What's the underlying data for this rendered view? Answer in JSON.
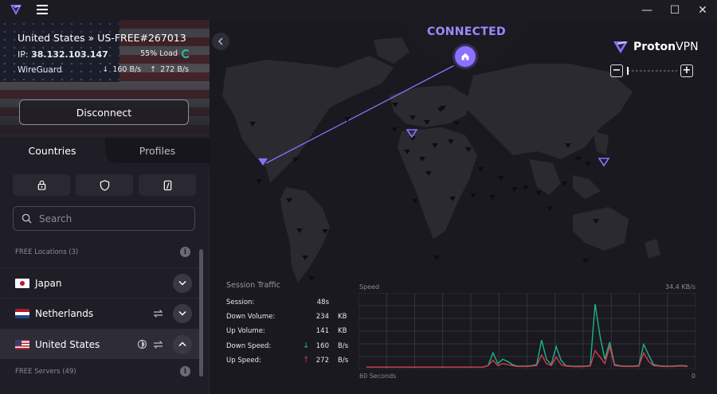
{
  "window": {
    "minimize_glyph": "—",
    "maximize_glyph": "☐",
    "close_glyph": "✕"
  },
  "connection": {
    "server_name": "United States » US-FREE#267013",
    "ip_label": "IP:",
    "ip": "38.132.103.147",
    "load": "55% Load",
    "load_percent": 55,
    "protocol": "WireGuard",
    "download_speed": "160 B/s",
    "upload_speed": "272 B/s",
    "disconnect_label": "Disconnect"
  },
  "tabs": {
    "countries": "Countries",
    "profiles": "Profiles"
  },
  "search": {
    "placeholder": "Search",
    "value": ""
  },
  "sections": {
    "free_locations": "FREE Locations (3)",
    "free_servers": "FREE Servers (49)",
    "info_glyph": "i"
  },
  "countries": [
    {
      "name": "Japan",
      "expanded": false
    },
    {
      "name": "Netherlands",
      "expanded": false
    },
    {
      "name": "United States",
      "expanded": true
    }
  ],
  "map": {
    "status": "CONNECTED",
    "brand_name": "Proton",
    "brand_suffix": "VPN",
    "zoom_out": "−",
    "zoom_in": "+",
    "colors": {
      "accent": "#8b71ff",
      "status_text": "#9d8aff",
      "marker": "#0e0d12"
    }
  },
  "session_traffic": {
    "title": "Session Traffic",
    "rows": [
      {
        "label": "Session:",
        "arrow": "",
        "value": "48s",
        "unit": ""
      },
      {
        "label": "Down Volume:",
        "arrow": "",
        "value": "234",
        "unit": "KB"
      },
      {
        "label": "Up Volume:",
        "arrow": "",
        "value": "141",
        "unit": "KB"
      },
      {
        "label": "Down Speed:",
        "arrow": "↓",
        "value": "160",
        "unit": "B/s"
      },
      {
        "label": "Up Speed:",
        "arrow": "↑",
        "value": "272",
        "unit": "B/s"
      }
    ]
  },
  "speed_graph": {
    "title": "Speed",
    "max_label": "34.4 KB/s",
    "x_left_label": "60 Seconds",
    "x_right_label": "0",
    "max_value": 34.4,
    "colors": {
      "download": "#1db38a",
      "upload": "#d8384f",
      "grid": "#3a3942"
    },
    "download": [
      0.3,
      0.3,
      0.3,
      0.3,
      0.3,
      0.3,
      0.3,
      0.3,
      0.3,
      0.3,
      0.3,
      0.3,
      0.3,
      0.3,
      0.3,
      0.3,
      0.3,
      0.3,
      0.3,
      0.3,
      0.3,
      0.3,
      0.3,
      0.3,
      0.3,
      1,
      7,
      2,
      4,
      3,
      1.5,
      0.8,
      0.8,
      0.8,
      1,
      1.5,
      13,
      4,
      1.5,
      10,
      3.5,
      1,
      0.8,
      0.7,
      0.7,
      0.8,
      1,
      30,
      15,
      4,
      12,
      1.5,
      1,
      0.8,
      0.8,
      0.8,
      1,
      11,
      6,
      1.5,
      1,
      0.8,
      0.8,
      0.8,
      1,
      1,
      0.8
    ],
    "upload": [
      0.3,
      0.3,
      0.3,
      0.3,
      0.3,
      0.3,
      0.3,
      0.3,
      0.3,
      0.3,
      0.3,
      0.3,
      0.3,
      0.3,
      0.3,
      0.3,
      0.3,
      0.3,
      0.3,
      0.3,
      0.3,
      0.3,
      0.3,
      0.3,
      0.3,
      1,
      3.5,
      1,
      2,
      1.5,
      1,
      0.6,
      0.6,
      0.6,
      0.8,
      1,
      6,
      2,
      1,
      5,
      1.5,
      0.8,
      0.6,
      0.5,
      0.5,
      0.6,
      0.8,
      8,
      5,
      2,
      10,
      1,
      0.8,
      0.6,
      0.6,
      0.6,
      0.8,
      7,
      3,
      1,
      0.8,
      0.6,
      0.6,
      0.6,
      0.8,
      0.8,
      0.6
    ]
  }
}
